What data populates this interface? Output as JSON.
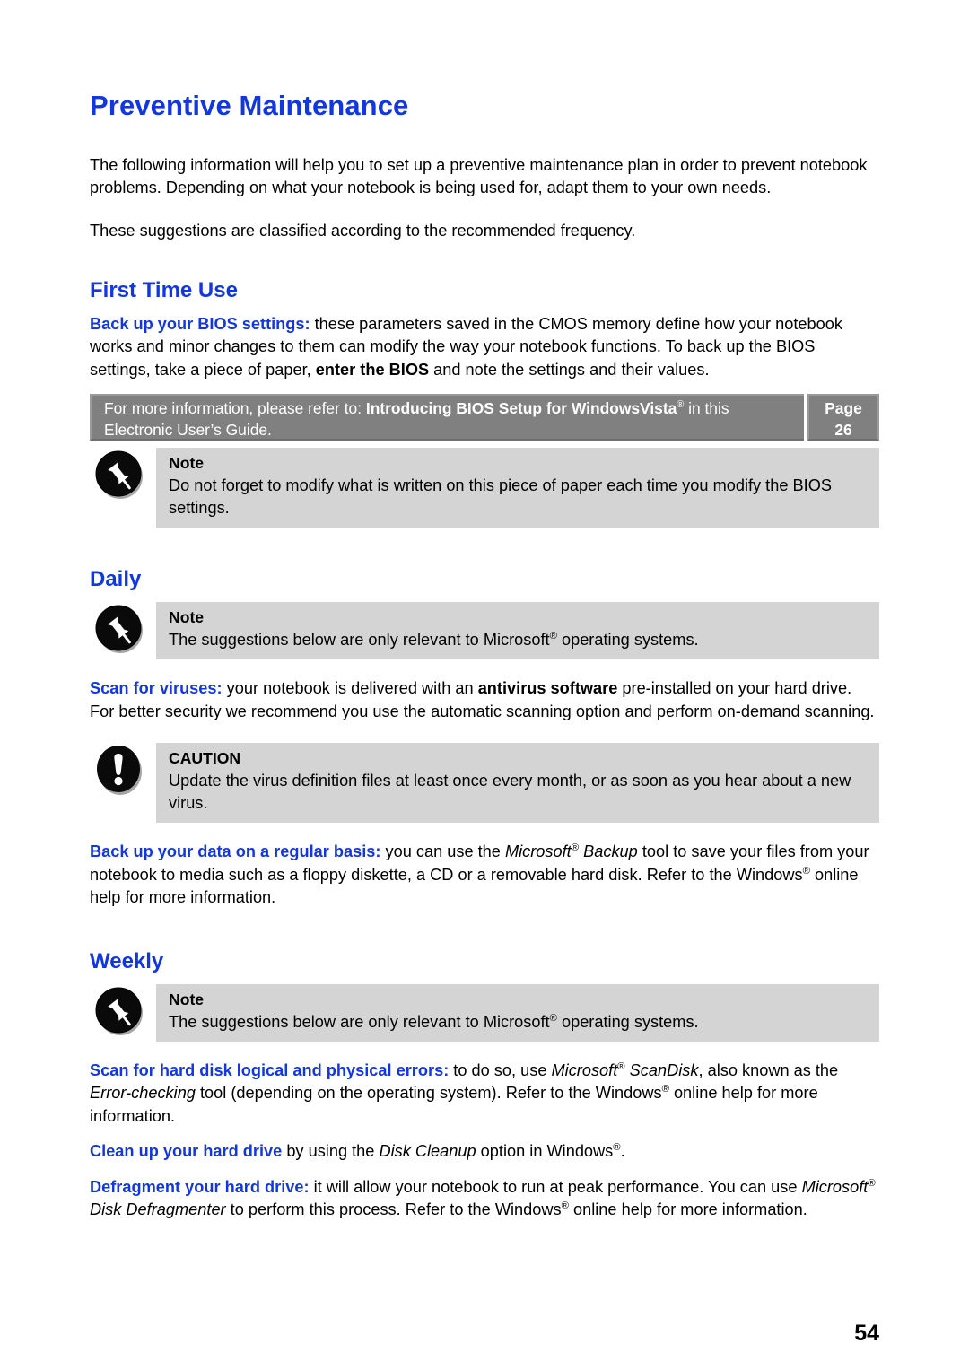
{
  "document": {
    "title": "Preventive Maintenance",
    "footer_page_number": "54",
    "accent_color": "#1337DF",
    "callout_bg": "#d4d4d4",
    "refer_bar_bg": "#808080"
  },
  "intro": {
    "paragraph_1": "The following information will help you to set up a preventive maintenance plan in order to prevent notebook problems. Depending on what your notebook is being used for, adapt them to your own needs.",
    "paragraph_2": "These suggestions are classified according to the recommended frequency."
  },
  "first_time_use": {
    "heading": "First Time Use",
    "bios_lead": "Back up your BIOS settings:",
    "bios_text_a": " these parameters saved in the CMOS memory define how your notebook works and minor changes to them can modify the way your notebook functions. To back up the BIOS settings, take a piece of paper, ",
    "bios_bold": "enter the BIOS",
    "bios_text_b": " and note the settings and their values.",
    "refer": {
      "prefix": "For more information, please refer to: ",
      "ref_title_a": "Introducing BIOS Setup for Windows",
      "ref_title_b": "Vista",
      "ref_suffix": " in this Electronic User’s Guide.",
      "page_label": "Page",
      "page_value": "26"
    },
    "note": {
      "icon": "pushpin-icon",
      "title": "Note",
      "text": "Do not forget to modify what is written on this piece of paper each time you modify the BIOS settings."
    }
  },
  "daily": {
    "heading": "Daily",
    "note": {
      "icon": "pushpin-icon",
      "title": "Note",
      "text_a": "The suggestions below are only relevant to Microsoft",
      "text_b": " operating systems."
    },
    "virus_lead": "Scan for viruses:",
    "virus_text_a": " your notebook is delivered with an ",
    "virus_bold": "antivirus software",
    "virus_text_b": " pre-installed on your hard drive. For better security we recommend you use the automatic scanning option and perform on-demand scanning.",
    "caution": {
      "icon": "exclamation-icon",
      "title": "CAUTION",
      "text": "Update the virus definition files at least once every month, or as soon as you hear about a new virus."
    },
    "backup_lead": "Back up your data on a regular basis:",
    "backup_text_a": " you can use the ",
    "backup_ital_1": "Microsoft",
    "backup_ital_2": " Backup",
    "backup_text_b": " tool to save your files from your notebook to media such as a floppy diskette, a CD or a removable hard disk. Refer to the Windows",
    "backup_text_c": " online help for more information."
  },
  "weekly": {
    "heading": "Weekly",
    "note": {
      "icon": "pushpin-icon",
      "title": "Note",
      "text_a": "The suggestions below are only relevant to Microsoft",
      "text_b": " operating systems."
    },
    "scandisk_lead": "Scan for hard disk logical and physical errors:",
    "scandisk_text_a": " to do so, use ",
    "scandisk_ital_1": "Microsoft",
    "scandisk_ital_2": " ScanDisk",
    "scandisk_text_b": ", also known as the ",
    "scandisk_ital_3": "Error-checking",
    "scandisk_text_c": " tool (depending on the operating system). Refer to the Windows",
    "scandisk_text_d": " online help for more information.",
    "cleanup_lead": "Clean up your hard drive",
    "cleanup_text_a": " by using the ",
    "cleanup_ital": "Disk Cleanup",
    "cleanup_text_b": " option in Windows",
    "cleanup_text_c": ".",
    "defrag_lead": "Defragment your hard drive:",
    "defrag_text_a": " it will allow your notebook to run at peak performance. You can use ",
    "defrag_ital_1": "Microsoft",
    "defrag_ital_2": " Disk Defragmenter",
    "defrag_text_b": " to perform this process. Refer to the Windows",
    "defrag_text_c": " online help for more information."
  },
  "symbols": {
    "registered": "®"
  }
}
